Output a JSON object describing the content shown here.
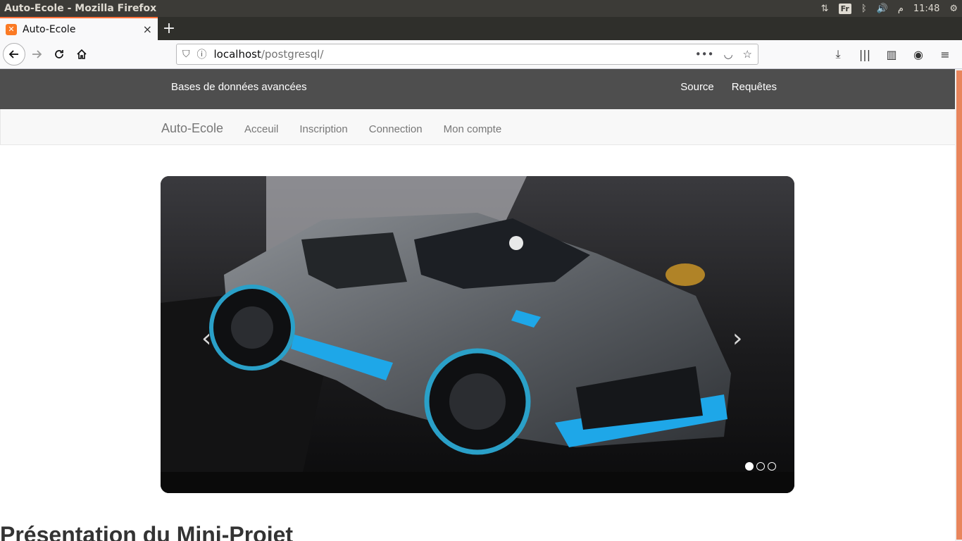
{
  "os": {
    "window_title": "Auto-Ecole - Mozilla Firefox",
    "keyboard_layout": "Fr",
    "language_mark": "م",
    "clock": "11:48"
  },
  "browser": {
    "tab_title": "Auto-Ecole",
    "url_host": "localhost",
    "url_path": "/postgresql/",
    "new_tab_label": "+"
  },
  "site": {
    "brand": "Bases de données avancées",
    "top_links": [
      "Source",
      "Requêtes"
    ],
    "sub_brand": "Auto-Ecole",
    "sub_links": [
      "Acceuil",
      "Inscription",
      "Connection",
      "Mon compte"
    ],
    "carousel": {
      "prev_label": "‹",
      "next_label": "›",
      "slide_count": 3,
      "active_index": 0
    },
    "section_title": "Présentation du Mini-Projet"
  },
  "colors": {
    "tab_accent": "#ff7139",
    "topnav_bg": "#4e4e4e",
    "subnav_bg": "#f8f8f8",
    "car_accent": "#1ea7e8"
  }
}
